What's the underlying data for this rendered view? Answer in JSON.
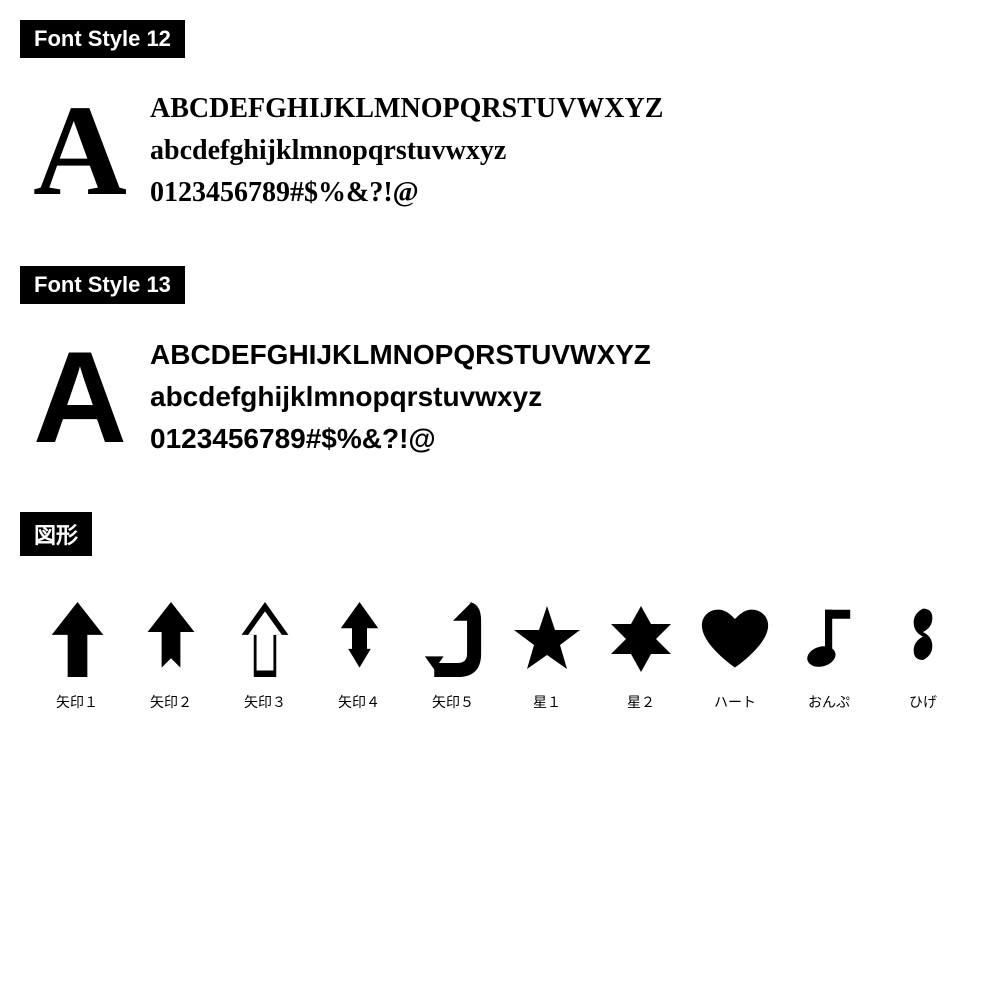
{
  "font_style_12": {
    "header": "Font Style 12",
    "big_letter": "A",
    "uppercase": "BCDEFGHIJKLMNOPQRSTUVWXYZ",
    "lowercase": "abcdefghijklmnopqrstuvwxyz",
    "numbers": "0123456789#$%&?!@"
  },
  "font_style_13": {
    "header": "Font Style 13",
    "big_letter": "A",
    "uppercase": "BCDEFGHIJKLMNOPQRSTUVWXYZ",
    "lowercase": "abcdefghijklmnopqrstuvwxyz",
    "numbers": "0123456789#$%&?!@"
  },
  "shapes": {
    "header": "図形",
    "items": [
      {
        "id": "arrow1",
        "label": "矢印１"
      },
      {
        "id": "arrow2",
        "label": "矢印２"
      },
      {
        "id": "arrow3",
        "label": "矢印３"
      },
      {
        "id": "arrow4",
        "label": "矢印４"
      },
      {
        "id": "arrow5",
        "label": "矢印５"
      },
      {
        "id": "star1",
        "label": "星１"
      },
      {
        "id": "star2",
        "label": "星２"
      },
      {
        "id": "heart",
        "label": "ハート"
      },
      {
        "id": "music",
        "label": "おんぷ"
      },
      {
        "id": "mustache",
        "label": "ひげ"
      }
    ]
  }
}
